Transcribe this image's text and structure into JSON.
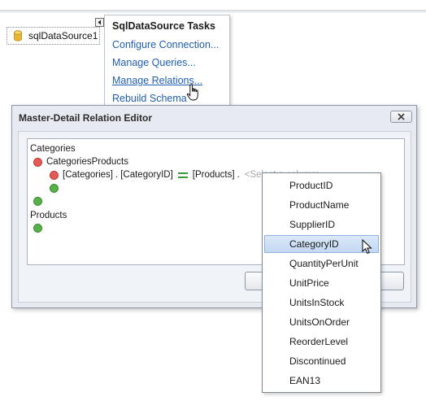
{
  "component": {
    "label": "sqlDataSource1",
    "icon": "database-icon"
  },
  "tasks_panel": {
    "title": "SqlDataSource Tasks",
    "links": [
      {
        "label": "Configure Connection..."
      },
      {
        "label": "Manage Queries..."
      },
      {
        "label": "Manage Relations...",
        "hovered": true
      },
      {
        "label": "Rebuild Schema"
      }
    ]
  },
  "dialog": {
    "title": "Master-Detail Relation Editor",
    "close_icon": "close-icon",
    "tree": {
      "master_table": "Categories",
      "relation_name": "CategoriesProducts",
      "condition": {
        "left_table": "[Categories]",
        "dot1": ".",
        "left_column": "[CategoryID]",
        "right_table": "[Products]",
        "dot2": ".",
        "right_column_placeholder": "<Select a column>"
      },
      "detail_table": "Products"
    }
  },
  "dropdown": {
    "items": [
      "ProductID",
      "ProductName",
      "SupplierID",
      "CategoryID",
      "QuantityPerUnit",
      "UnitPrice",
      "UnitsInStock",
      "UnitsOnOrder",
      "ReorderLevel",
      "Discontinued",
      "EAN13"
    ],
    "selected": "CategoryID"
  },
  "colors": {
    "link": "#1f5fb0",
    "selection": "#c3d8f3",
    "remove": "#e35b55",
    "add": "#58b148",
    "equals": "#3b9a3b",
    "dialog_bg": "#e7ebf1"
  }
}
